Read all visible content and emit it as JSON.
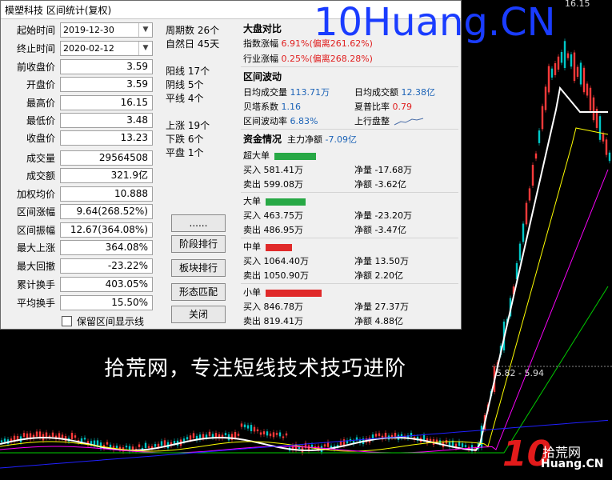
{
  "window": {
    "title": "模塑科技  区间统计(复权)"
  },
  "form": {
    "start_label": "起始时间",
    "start_value": "2019-12-30",
    "end_label": "终止时间",
    "end_value": "2020-02-12",
    "fields": [
      {
        "label": "前收盘价",
        "value": "3.59"
      },
      {
        "label": "开盘价",
        "value": "3.59"
      },
      {
        "label": "最高价",
        "value": "16.15"
      },
      {
        "label": "最低价",
        "value": "3.48"
      },
      {
        "label": "收盘价",
        "value": "13.23"
      },
      {
        "label": "成交量",
        "value": "29564508"
      },
      {
        "label": "成交额",
        "value": "321.9亿"
      },
      {
        "label": "加权均价",
        "value": "10.888"
      },
      {
        "label": "区间涨幅",
        "value": "9.64(268.52%)"
      },
      {
        "label": "区间振幅",
        "value": "12.67(364.08%)"
      },
      {
        "label": "最大上涨",
        "value": "364.08%"
      },
      {
        "label": "最大回撤",
        "value": "-23.22%"
      },
      {
        "label": "累计换手",
        "value": "403.05%"
      },
      {
        "label": "平均换手",
        "value": "15.50%"
      }
    ],
    "keep_display_label": "保留区间显示线"
  },
  "middle": {
    "lines": [
      "周期数 26个",
      "自然日 45天",
      "阳线 17个",
      "阴线 5个",
      "平线 4个",
      "上涨 19个",
      "下跌 6个",
      "平盘 1个"
    ],
    "buttons": [
      "......",
      "阶段排行",
      "板块排行",
      "形态匹配",
      "关闭"
    ]
  },
  "market": {
    "title": "大盘对比",
    "index_label": "指数涨幅",
    "index_value": "6.91%",
    "index_dev": "(偏离261.62%)",
    "industry_label": "行业涨幅",
    "industry_value": "0.25%",
    "industry_dev": "(偏离268.28%)"
  },
  "volatility": {
    "title": "区间波动",
    "avg_vol_label": "日均成交量",
    "avg_vol_value": "113.71万",
    "avg_amt_label": "日均成交额",
    "avg_amt_value": "12.38亿",
    "beta_label": "贝塔系数",
    "beta_value": "1.16",
    "sharpe_label": "夏普比率",
    "sharpe_value": "0.79",
    "vol_rate_label": "区间波动率",
    "vol_rate_value": "6.83%",
    "trend_label": "上行盘整"
  },
  "funds": {
    "title": "资金情况",
    "main_label": "主力净额",
    "main_value": "-7.09亿",
    "groups": [
      {
        "name": "超大单",
        "buy": "买入 581.41万",
        "sell": "卖出 599.08万",
        "net_vol": "净量 -17.68万",
        "net_amt": "净额 -3.62亿",
        "color": "#27a845"
      },
      {
        "name": "大单",
        "buy": "买入 463.75万",
        "sell": "卖出 486.95万",
        "net_vol": "净量 -23.20万",
        "net_amt": "净额 -3.47亿",
        "color": "#27a845"
      },
      {
        "name": "中单",
        "buy": "买入 1064.40万",
        "sell": "卖出 1050.90万",
        "net_vol": "净量 13.50万",
        "net_amt": "净额 2.20亿",
        "color": "#e02a2a"
      },
      {
        "name": "小单",
        "buy": "买入 846.78万",
        "sell": "卖出 819.41万",
        "net_vol": "净量 27.37万",
        "net_amt": "净额 4.88亿",
        "color": "#e02a2a"
      }
    ]
  },
  "chart": {
    "high_label": "16.15",
    "range_label": "5.82 - 5.94"
  },
  "overlay": {
    "caption": "拾荒网，专注短线技术技巧进阶",
    "watermark": "10Huang.CN",
    "logo_cn": "拾荒网",
    "logo_en": "Huang.CN",
    "logo_num": "10"
  },
  "colors": {
    "up": "#ff3b3b",
    "down": "#00c8c8",
    "ma5": "#ffffff",
    "ma10": "#ffff00",
    "ma20": "#ff00ff",
    "ma60": "#00cc00",
    "ma120": "#2020ff"
  }
}
